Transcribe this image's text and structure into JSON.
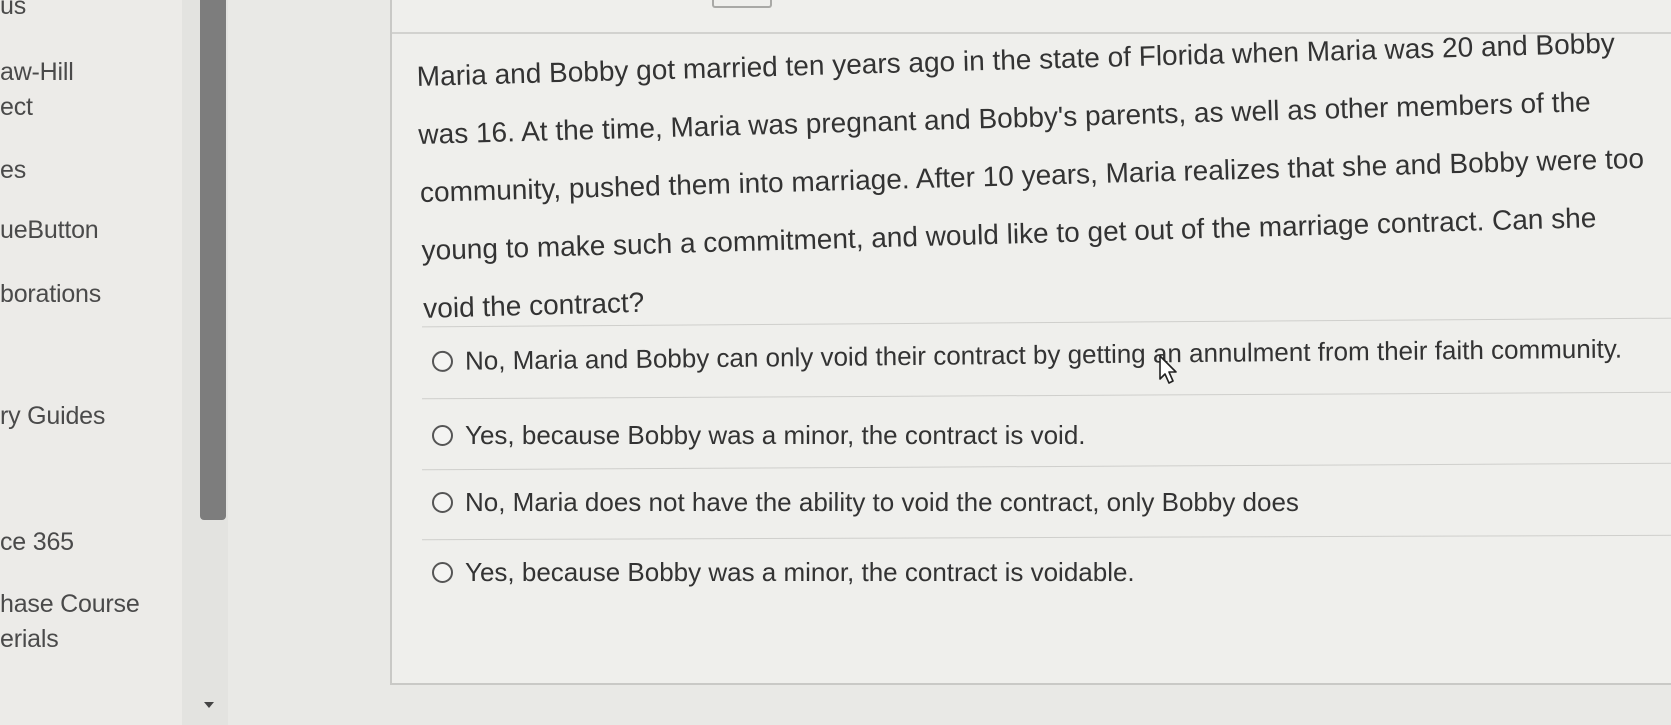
{
  "sidebar": {
    "items": [
      {
        "label": "us"
      },
      {
        "label": "aw-Hill",
        "label2": "ect"
      },
      {
        "label": "es"
      },
      {
        "label": "ueButton"
      },
      {
        "label": "borations"
      },
      {
        "label": "ry Guides"
      },
      {
        "label": "ce 365"
      },
      {
        "label": "hase Course",
        "label2": "erials"
      }
    ]
  },
  "question": {
    "text": "Maria and Bobby got married ten years ago in the state of Florida when Maria was 20 and Bobby was 16. At the time, Maria was pregnant and Bobby's parents, as well as other members of the community, pushed them into marriage. After 10 years, Maria realizes that she and Bobby were too young to make such a commitment, and would like to get out of the marriage contract. Can she void the contract?",
    "options": [
      {
        "label": "No, Maria and Bobby can only void their contract by getting an annulment from their faith community."
      },
      {
        "label": "Yes, because Bobby was a minor, the contract is void."
      },
      {
        "label": "No, Maria does not have the ability to void the contract, only Bobby does"
      },
      {
        "label": "Yes, because Bobby was a minor, the contract is voidable."
      }
    ]
  },
  "colors": {
    "background": "#e9e9e6",
    "card": "#efefec",
    "scroll_thumb": "#7d7d7d",
    "text": "#333333"
  },
  "icons": {
    "scroll_down": "caret-down-icon",
    "cursor": "pointer-cursor-icon",
    "radio": "radio-unselected-icon"
  }
}
